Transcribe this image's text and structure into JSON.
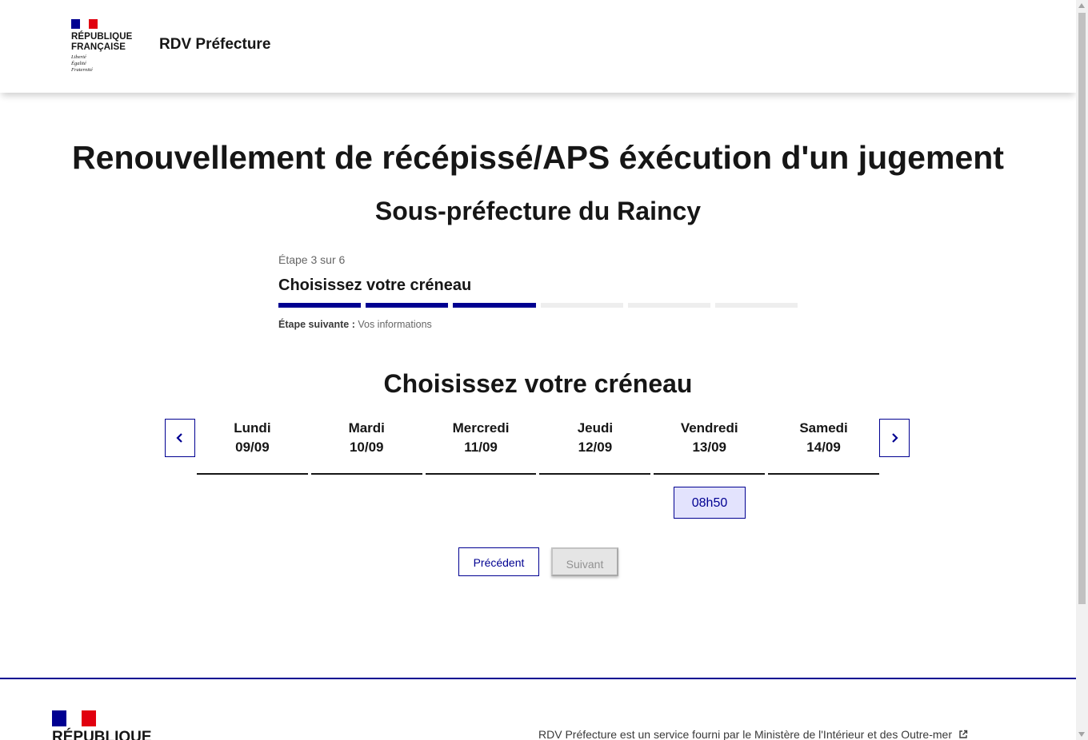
{
  "header": {
    "logo_title": "RÉPUBLIQUE\nFRANÇAISE",
    "logo_motto": "Liberté\nÉgalité\nFraternité",
    "service_title": "RDV Préfecture"
  },
  "main": {
    "title": "Renouvellement de récépissé/APS éxécution d'un jugement",
    "subtitle": "Sous-préfecture du Raincy"
  },
  "stepper": {
    "state": "Étape 3 sur 6",
    "current_title": "Choisissez votre créneau",
    "current_step": 3,
    "total_steps": 6,
    "next_label": "Étape suivante :",
    "next_value": "Vos informations"
  },
  "slots_section": {
    "title": "Choisissez votre créneau",
    "days": [
      {
        "name": "Lundi",
        "date": "09/09"
      },
      {
        "name": "Mardi",
        "date": "10/09"
      },
      {
        "name": "Mercredi",
        "date": "11/09"
      },
      {
        "name": "Jeudi",
        "date": "12/09"
      },
      {
        "name": "Vendredi",
        "date": "13/09"
      },
      {
        "name": "Samedi",
        "date": "14/09"
      }
    ],
    "slot": {
      "day": "Vendredi",
      "time": "08h50"
    }
  },
  "actions": {
    "previous": "Précédent",
    "next": "Suivant"
  },
  "footer": {
    "logo_title": "RÉPUBLIQUE",
    "text": "RDV Préfecture est un service fourni par le Ministère de l'Intérieur et des Outre-mer"
  },
  "colors": {
    "primary": "#000091",
    "marianne_red": "#e1000f",
    "slot_bg": "#e3e3fd",
    "disabled_bg": "#e5e5e5"
  },
  "icons": [
    "chevron-left-icon",
    "chevron-right-icon",
    "external-link-icon",
    "flag-icon"
  ]
}
